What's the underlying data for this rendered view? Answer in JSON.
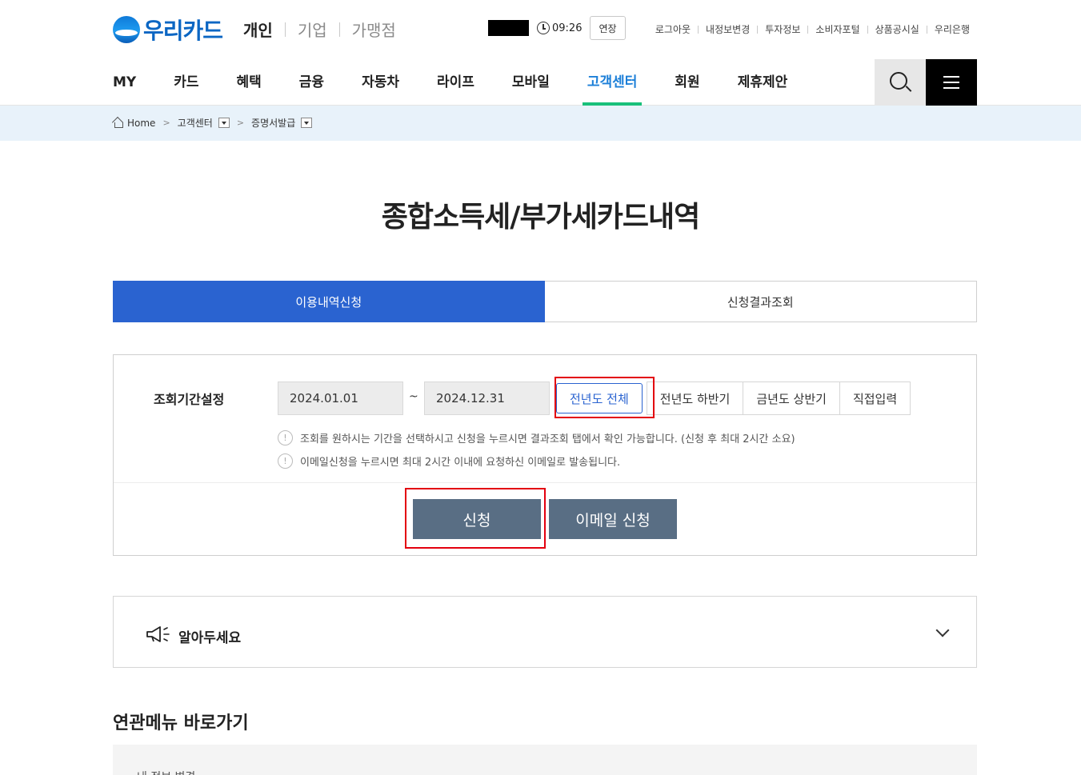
{
  "header": {
    "logo_text": "우리카드",
    "segments": [
      "개인",
      "기업",
      "가맹점"
    ],
    "session_time": "09:26",
    "extend_label": "연장",
    "util_links": [
      "로그아웃",
      "내정보변경",
      "투자정보",
      "소비자포털",
      "상품공시실",
      "우리은행"
    ]
  },
  "gnb": {
    "items": [
      "MY",
      "카드",
      "혜택",
      "금융",
      "자동차",
      "라이프",
      "모바일",
      "고객센터",
      "회원",
      "제휴제안"
    ],
    "active_index": 7
  },
  "breadcrumb": {
    "home": "Home",
    "level1": "고객센터",
    "level2": "증명서발급"
  },
  "page_title": "종합소득세/부가세카드내역",
  "tabs": [
    {
      "label": "이용내역신청",
      "active": true
    },
    {
      "label": "신청결과조회",
      "active": false
    }
  ],
  "query": {
    "label": "조회기간설정",
    "start_date": "2024.01.01",
    "tilde": "~",
    "end_date": "2024.12.31",
    "periods": [
      "전년도 전체",
      "전년도 하반기",
      "금년도 상반기",
      "직접입력"
    ],
    "selected_period": "전년도 전체",
    "notices": [
      "조회를 원하시는 기간을 선택하시고 신청을 누르시면 결과조회 탭에서 확인 가능합니다. (신청 후 최대 2시간 소요)",
      "이메일신청을 누르시면 최대 2시간 이내에 요청하신 이메일로 발송됩니다."
    ],
    "notice_icon_glyph": "!",
    "apply_label": "신청",
    "email_label": "이메일 신청"
  },
  "accordion": {
    "title": "알아두세요"
  },
  "related": {
    "title": "연관메뉴 바로가기",
    "first_item": "내 정보 변경"
  },
  "colors": {
    "primary_tab": "#2a63d0",
    "action_button": "#596e84",
    "gnb_active_text": "#1c7fd8",
    "gnb_active_bar": "#19c07a",
    "breadcrumb_bg": "#e8f2fa",
    "annotation_box": "#e3000f"
  }
}
